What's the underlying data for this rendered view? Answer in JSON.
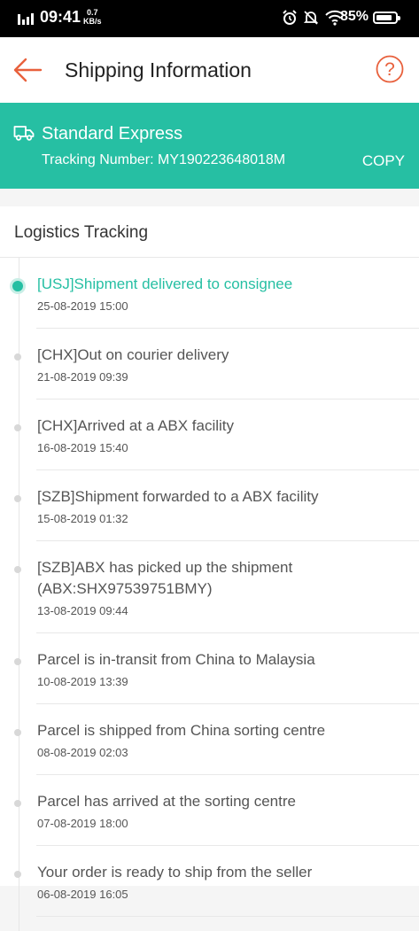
{
  "status_bar": {
    "time": "09:41",
    "speed_value": "0.7",
    "speed_unit": "KB/s",
    "battery_percent": "85%",
    "battery_level": 0.85
  },
  "header": {
    "title": "Shipping Information"
  },
  "banner": {
    "service": "Standard Express",
    "tracking": "Tracking Number: MY190223648018M",
    "copy_label": "COPY"
  },
  "logistics": {
    "title": "Logistics Tracking",
    "events": [
      {
        "text": "[USJ]Shipment delivered to consignee",
        "date": "25-08-2019 15:00"
      },
      {
        "text": "[CHX]Out on courier delivery",
        "date": "21-08-2019 09:39"
      },
      {
        "text": "[CHX]Arrived at a ABX facility",
        "date": "16-08-2019 15:40"
      },
      {
        "text": "[SZB]Shipment forwarded to a ABX facility",
        "date": "15-08-2019 01:32"
      },
      {
        "text": "[SZB]ABX has picked up the shipment (ABX:SHX97539751BMY)",
        "date": "13-08-2019 09:44"
      },
      {
        "text": "Parcel is in-transit from China to Malaysia",
        "date": "10-08-2019 13:39"
      },
      {
        "text": "Parcel is shipped from China sorting centre",
        "date": "08-08-2019 02:03"
      },
      {
        "text": "Parcel has arrived at the sorting centre",
        "date": "07-08-2019 18:00"
      },
      {
        "text": "Your order is ready to ship from the seller",
        "date": "06-08-2019 16:05"
      }
    ]
  },
  "colors": {
    "accent": "#26bfa3",
    "back_arrow": "#e8603c"
  }
}
